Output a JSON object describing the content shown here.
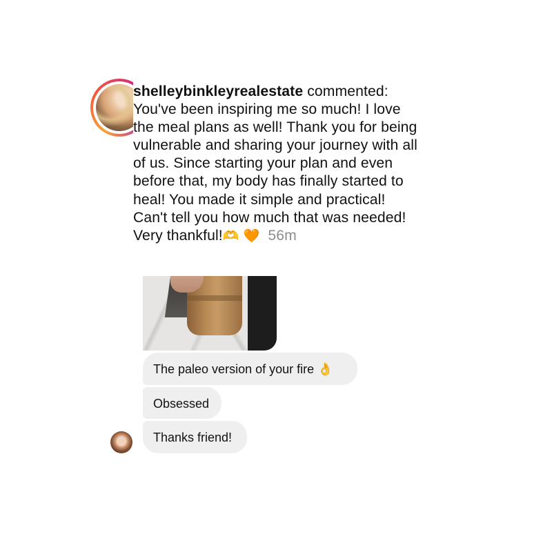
{
  "comment": {
    "username": "shelleybinkleyrealestate",
    "action": "commented:",
    "lines": [
      "You've been inspiring me so much!  I love",
      "the meal plans as well!  Thank you for being",
      "vulnerable and sharing your journey with all",
      "of us.  Since starting your plan and even",
      "before that, my body has finally started to",
      "heal!  You made it simple and practical!",
      "Can't tell you how much that was needed!",
      "Very thankful!"
    ],
    "emoji_1": "🫶",
    "emoji_2": "🧡",
    "time": "56m"
  },
  "dm": {
    "messages": [
      {
        "text": "The paleo version of your fire",
        "emoji": "👌"
      },
      {
        "text": "Obsessed"
      },
      {
        "text": "Thanks friend!"
      }
    ],
    "attachment_icon": "iced-coffee-photo"
  },
  "colors": {
    "bubble_bg": "#efefef",
    "timestamp": "#8e8e8e",
    "story_ring": [
      "#f9a13a",
      "#d62d7a",
      "#b326a6"
    ]
  }
}
